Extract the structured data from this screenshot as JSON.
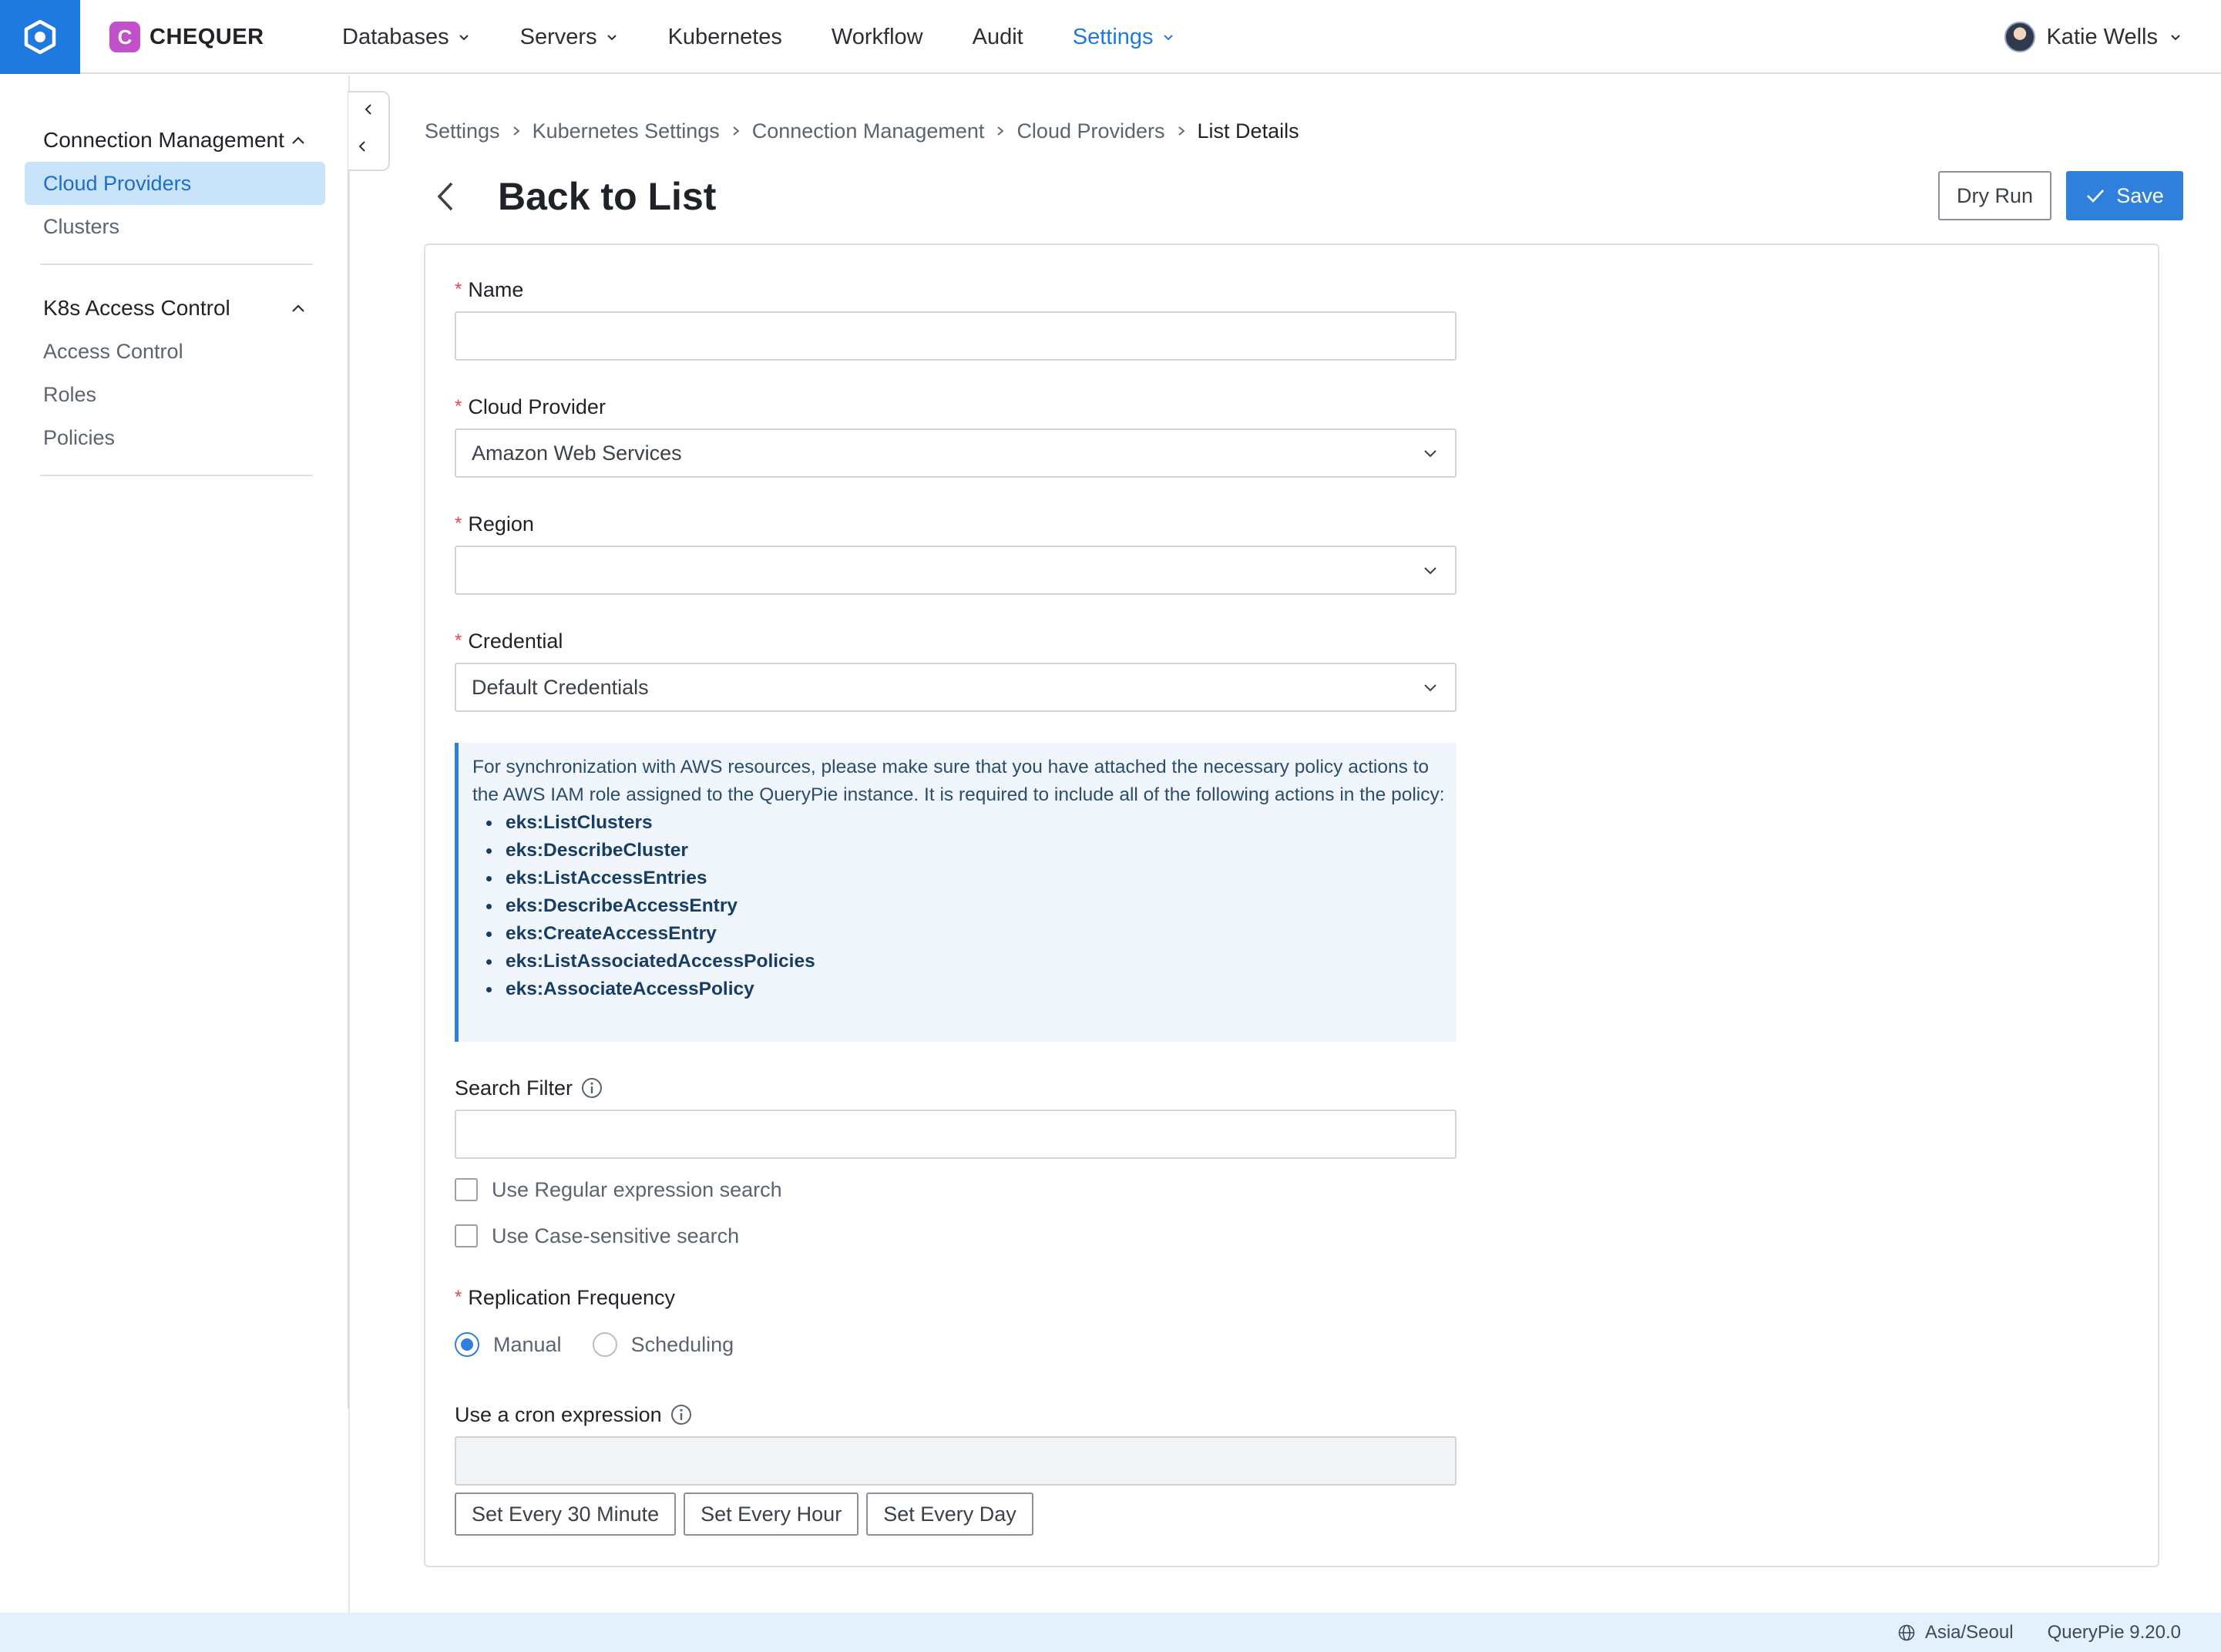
{
  "topbar": {
    "brand": "CHEQUER",
    "brand_initial": "C",
    "nav": [
      {
        "label": "Databases",
        "has_menu": true,
        "active": false
      },
      {
        "label": "Servers",
        "has_menu": true,
        "active": false
      },
      {
        "label": "Kubernetes",
        "has_menu": false,
        "active": false
      },
      {
        "label": "Workflow",
        "has_menu": false,
        "active": false
      },
      {
        "label": "Audit",
        "has_menu": false,
        "active": false
      },
      {
        "label": "Settings",
        "has_menu": true,
        "active": true
      }
    ],
    "user_name": "Katie Wells",
    "accent_color": "#1f7ae0"
  },
  "sidebar": {
    "sections": [
      {
        "title": "Connection Management",
        "items": [
          "Cloud Providers",
          "Clusters"
        ],
        "selected": "Cloud Providers"
      },
      {
        "title": "K8s Access Control",
        "items": [
          "Access Control",
          "Roles",
          "Policies"
        ]
      }
    ]
  },
  "breadcrumb": [
    "Settings",
    "Kubernetes Settings",
    "Connection Management",
    "Cloud Providers",
    "List Details"
  ],
  "page": {
    "title": "Back to List",
    "dry_run_label": "Dry Run",
    "save_label": "Save"
  },
  "form": {
    "name": {
      "label": "Name",
      "value": "",
      "placeholder": ""
    },
    "cloud_provider": {
      "label": "Cloud Provider",
      "value": "Amazon Web Services"
    },
    "region": {
      "label": "Region",
      "value": ""
    },
    "credential": {
      "label": "Credential",
      "value": "Default Credentials"
    },
    "notice": {
      "text": "For synchronization with AWS resources, please make sure that you have attached the necessary policy actions to the AWS IAM role assigned to the QueryPie instance. It is required to include all of the following actions in the policy:",
      "actions": [
        "eks:ListClusters",
        "eks:DescribeCluster",
        "eks:ListAccessEntries",
        "eks:DescribeAccessEntry",
        "eks:CreateAccessEntry",
        "eks:ListAssociatedAccessPolicies",
        "eks:AssociateAccessPolicy"
      ]
    },
    "search_filter": {
      "label": "Search Filter",
      "value": "",
      "regex_label": "Use Regular expression search",
      "regex_checked": false,
      "case_label": "Use Case-sensitive search",
      "case_checked": false
    },
    "replication": {
      "label": "Replication Frequency",
      "options": [
        "Manual",
        "Scheduling"
      ],
      "selected": "Manual"
    },
    "cron": {
      "label": "Use a cron expression",
      "value": "",
      "buttons": [
        "Set Every 30 Minute",
        "Set Every Hour",
        "Set Every Day"
      ]
    }
  },
  "footer": {
    "timezone": "Asia/Seoul",
    "version": "QueryPie 9.20.0"
  }
}
